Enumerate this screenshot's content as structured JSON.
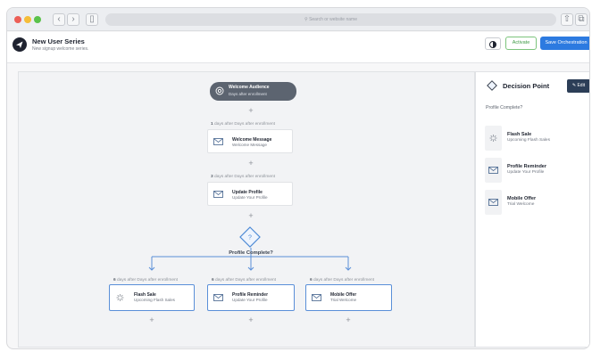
{
  "browser": {
    "url_placeholder": "Search or website name",
    "traffic_lights": [
      "#ec5f57",
      "#f5bd38",
      "#5ac24a"
    ]
  },
  "header": {
    "title": "New User Series",
    "subtitle": "New signup welcome series.",
    "activate_label": "Activate",
    "save_label": "Save Orchestration"
  },
  "flow": {
    "start": {
      "title": "Welcome Audience",
      "subtitle": "Days after enrollment"
    },
    "steps": [
      {
        "delay_num": "1",
        "delay_text": "days after Days after enrollment",
        "title": "Welcome Message",
        "subtitle": "Welcome Message",
        "icon": "envelope-icon"
      },
      {
        "delay_num": "3",
        "delay_text": "days after Days after enrollment",
        "title": "Update Profile",
        "subtitle": "Update Your Profile",
        "icon": "envelope-icon"
      }
    ],
    "decision": {
      "symbol": "?",
      "label": "Profile Complete?"
    },
    "branches": [
      {
        "delay_num": "6",
        "delay_text": "days after Days after enrollment",
        "title": "Flash Sale",
        "subtitle": "Upcoming Flash Sales",
        "icon": "loading-spinner-icon"
      },
      {
        "delay_num": "6",
        "delay_text": "days after Days after enrollment",
        "title": "Profile Reminder",
        "subtitle": "Update Your Profile",
        "icon": "envelope-icon"
      },
      {
        "delay_num": "6",
        "delay_text": "days after Days after enrollment",
        "title": "Mobile Offer",
        "subtitle": "Trial Welcome",
        "icon": "envelope-icon"
      }
    ],
    "plus_symbol": "+"
  },
  "panel": {
    "title": "Decision Point",
    "edit_label": "✎ Edit",
    "question": "Profile Complete?",
    "branches": [
      {
        "title": "Flash Sale",
        "subtitle": "Upcoming Flash Sales",
        "icon": "loading-spinner-icon"
      },
      {
        "title": "Profile Reminder",
        "subtitle": "Update Your Profile",
        "icon": "envelope-icon"
      },
      {
        "title": "Mobile Offer",
        "subtitle": "Trial Welcome",
        "icon": "envelope-icon"
      }
    ]
  },
  "colors": {
    "accent": "#2c7ae0",
    "activate": "#3f9a46",
    "connector": "#5a8fd8",
    "start_pill": "#5c6470"
  }
}
